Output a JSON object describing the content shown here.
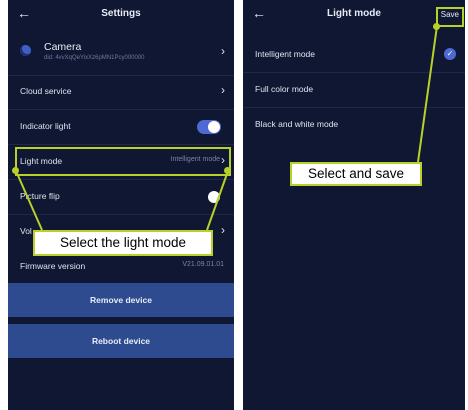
{
  "settings": {
    "title": "Settings",
    "camera": {
      "name": "Camera",
      "did": "did: 4vvXqQeYixXz6pMN1Pcy000000"
    },
    "rows": {
      "cloud_service": "Cloud service",
      "indicator_light": "Indicator light",
      "light_mode": "Light mode",
      "light_mode_value": "Intelligent mode",
      "picture_flip": "Picture flip",
      "volume": "Vol",
      "firmware_version": "Firmware version",
      "firmware_value": "V21.09.01.01"
    },
    "toggles": {
      "indicator_light": true,
      "picture_flip": false
    },
    "buttons": {
      "remove": "Remove device",
      "reboot": "Reboot device"
    },
    "callout": "Select the light mode"
  },
  "light_mode": {
    "title": "Light mode",
    "save": "Save",
    "options": [
      "Intelligent mode",
      "Full color mode",
      "Black and white mode"
    ],
    "selected_index": 0,
    "callout": "Select and save"
  },
  "colors": {
    "background": "#0f1732",
    "accent": "#4d6ad3",
    "button": "#2e4b90",
    "highlight": "#b8d12a"
  }
}
